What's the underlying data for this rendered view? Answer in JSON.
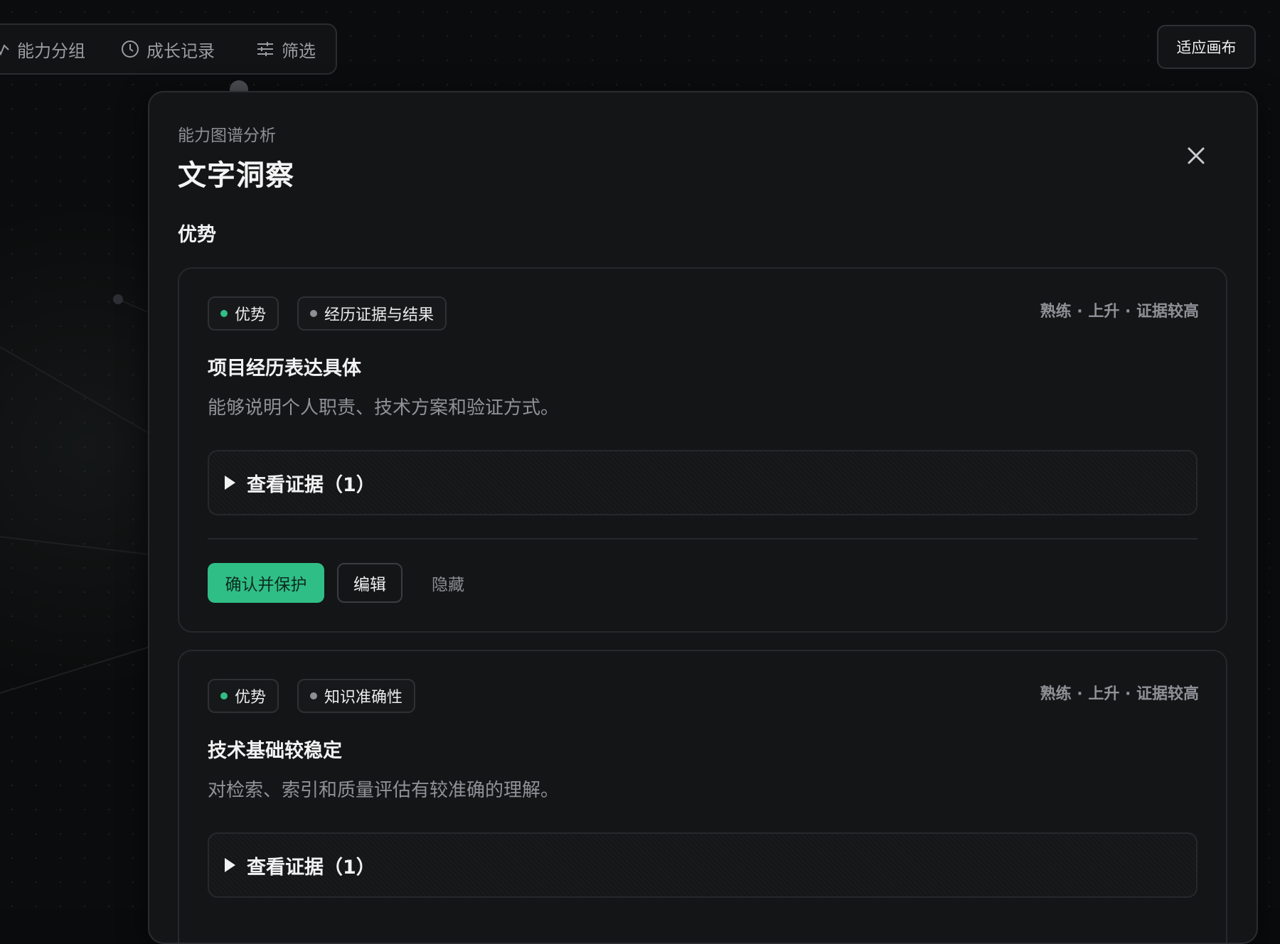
{
  "toolbar": {
    "grouping_label": "能力分组",
    "growth_label": "成长记录",
    "filter_label": "筛选"
  },
  "canvas": {
    "fit_button_label": "适应画布"
  },
  "panel": {
    "subtitle": "能力图谱分析",
    "title": "文字洞察",
    "section_title": "优势",
    "cards": [
      {
        "tag_primary": "优势",
        "tag_secondary": "经历证据与结果",
        "meta": "熟练 · 上升 · 证据较高",
        "title": "项目经历表达具体",
        "description": "能够说明个人职责、技术方案和验证方式。",
        "evidence_label": "查看证据（1）",
        "actions": {
          "confirm": "确认并保护",
          "edit": "编辑",
          "hide": "隐藏"
        }
      },
      {
        "tag_primary": "优势",
        "tag_secondary": "知识准确性",
        "meta": "熟练 · 上升 · 证据较高",
        "title": "技术基础较稳定",
        "description": "对检索、索引和质量评估有较准确的理解。",
        "evidence_label": "查看证据（1）"
      }
    ]
  },
  "colors": {
    "accent_green": "#2fbf86",
    "tag_dot_gray": "#8c8f94",
    "background": "#0b0c0d",
    "panel": "#141517"
  },
  "icons": {
    "grouping": "chart-icon",
    "growth": "clock-icon",
    "filter": "sliders-icon",
    "close": "close-icon",
    "expand": "triangle-right-icon"
  }
}
